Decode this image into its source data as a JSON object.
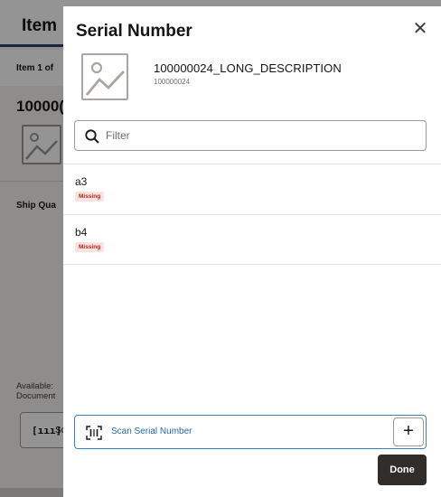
{
  "background": {
    "title": "Item",
    "item_position": "Item 1 of",
    "item_number": "10000(",
    "ship_quantity_label": "Ship Qua",
    "available_label": "Available:",
    "documents_label": "Document",
    "scan_label": "Sc"
  },
  "modal": {
    "title": "Serial Number",
    "close_icon": "close-icon",
    "product": {
      "name": "100000024_LONG_DESCRIPTION",
      "id": "100000024",
      "image_icon": "image-placeholder-icon"
    },
    "filter": {
      "placeholder": "Filter",
      "value": "",
      "icon": "search-icon"
    },
    "serials": [
      {
        "label": "a3",
        "status": "Missing"
      },
      {
        "label": "b4",
        "status": "Missing"
      }
    ],
    "scan": {
      "label": "Scan Serial Number",
      "icon": "barcode-scan-icon",
      "add_label": "+"
    },
    "done_label": "Done"
  },
  "colors": {
    "badge_bg": "#fbe3e1",
    "badge_text": "#b3271a",
    "scan_accent": "#2467a8",
    "done_bg": "#312d2a"
  }
}
